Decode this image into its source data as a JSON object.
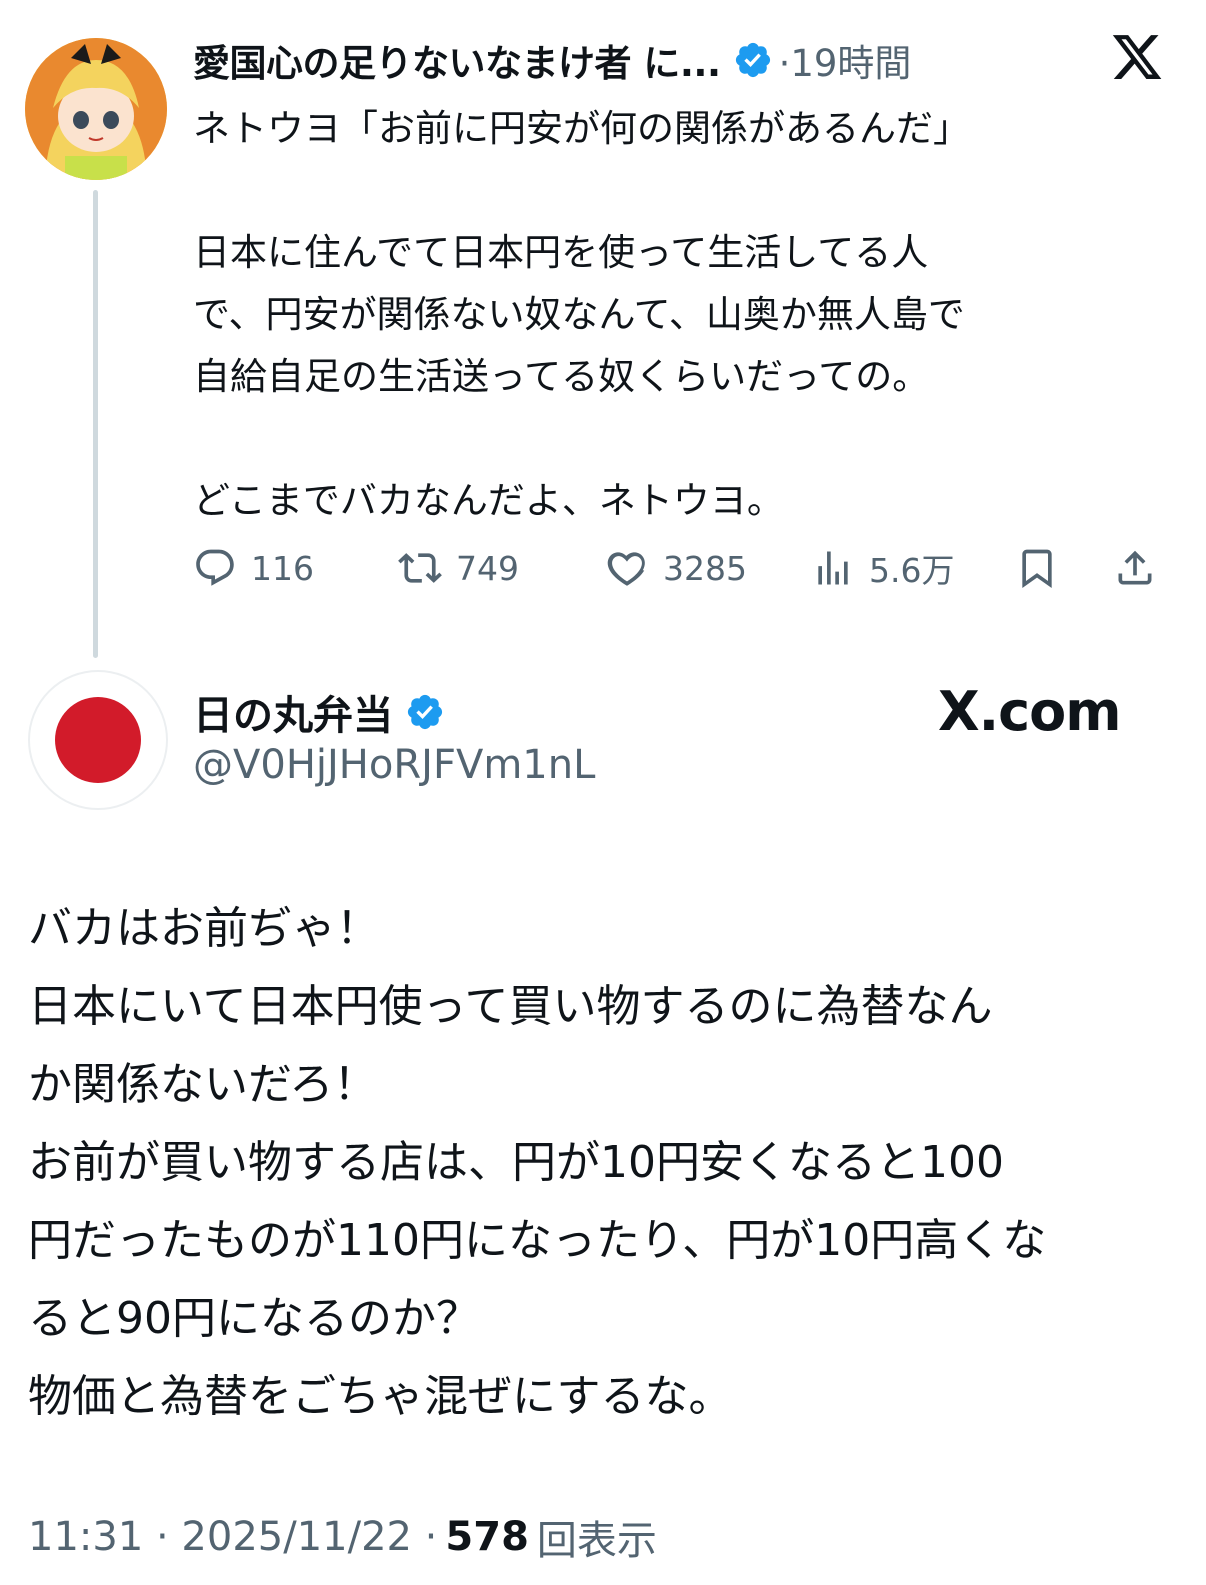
{
  "tweet1": {
    "author_name": "愛国心の足りないなまけ者 に...",
    "verified_icon": "verified-badge-icon",
    "time": "·19時間",
    "text": "ネトウヨ「お前に円安が何の関係があるんだ」\n\n日本に住んでて日本円を使って生活してる人\nで、円安が関係ない奴なんて、山奥か無人島で\n自給自足の生活送ってる奴くらいだっての。\n\nどこまでバカなんだよ、ネトウヨ。",
    "actions": {
      "replies": "116",
      "retweets": "749",
      "likes": "3285",
      "views": "5.6万"
    },
    "icons": [
      "reply-icon",
      "retweet-icon",
      "like-icon",
      "views-icon",
      "bookmark-icon",
      "share-icon"
    ]
  },
  "tweet2": {
    "author_name": "日の丸弁当",
    "handle": "@V0HjJHoRJFVm1nL",
    "brand": "X.com",
    "text": "バカはお前ぢゃ！\n日本にいて日本円使って買い物するのに為替なん\nか関係ないだろ！\nお前が買い物する店は、円が10円安くなると100\n円だったものが110円になったり、円が10円高くな\nると90円になるのか？\n物価と為替をごちゃ混ぜにするな。",
    "timestamp": "11:31 · 2025/11/22 ·",
    "views_count": "578",
    "views_label": "回表示"
  },
  "colors": {
    "text": "#0f1419",
    "secondary": "#536471",
    "verified": "#1d9bf0",
    "thread_line": "#cfd9de",
    "hinomaru_red": "#d21b2a"
  }
}
